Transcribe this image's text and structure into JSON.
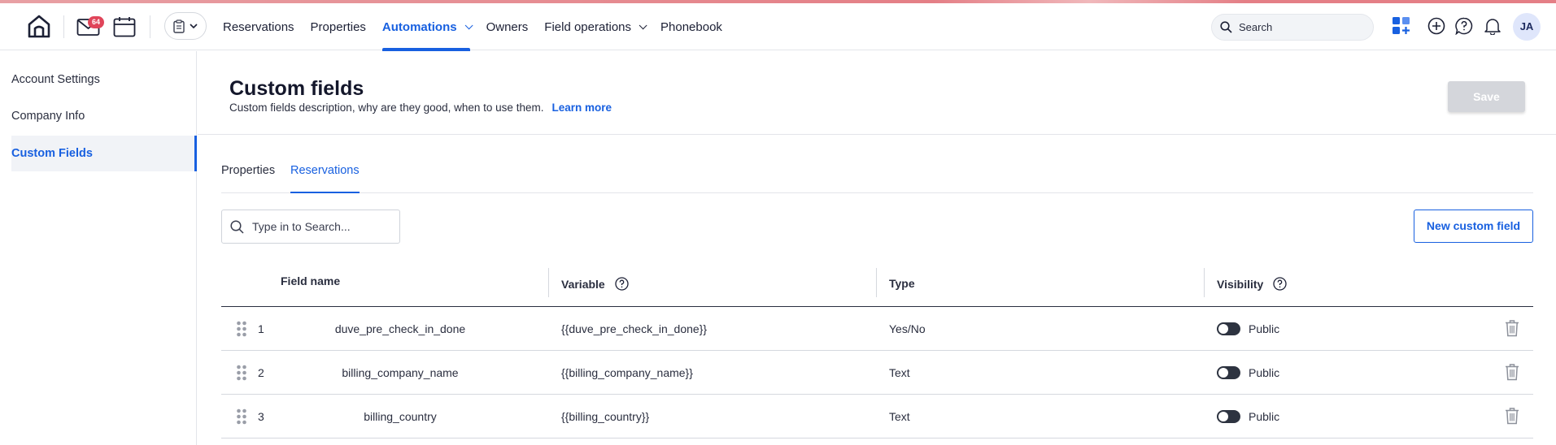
{
  "topbar": {
    "mail_badge": "64",
    "nav": [
      {
        "label": "Reservations",
        "has_caret": false,
        "active": false
      },
      {
        "label": "Properties",
        "has_caret": false,
        "active": false
      },
      {
        "label": "Automations",
        "has_caret": true,
        "active": true
      },
      {
        "label": "Owners",
        "has_caret": false,
        "active": false
      },
      {
        "label": "Field operations",
        "has_caret": true,
        "active": false
      },
      {
        "label": "Phonebook",
        "has_caret": false,
        "active": false
      }
    ],
    "search_label": "Search",
    "avatar_initials": "JA",
    "accent_color": "#1860e0",
    "badge_color": "#e0455a"
  },
  "sidebar": {
    "items": [
      {
        "label": "Account Settings",
        "active": false
      },
      {
        "label": "Company Info",
        "active": false
      },
      {
        "label": "Custom Fields",
        "active": true
      }
    ]
  },
  "header": {
    "title": "Custom fields",
    "description": "Custom fields description, why are they good, when to use them.",
    "learn_more": "Learn more",
    "save_label": "Save"
  },
  "tabs": [
    {
      "label": "Properties",
      "active": false
    },
    {
      "label": "Reservations",
      "active": true
    }
  ],
  "toolbar": {
    "search_placeholder": "Type in to Search...",
    "new_button": "New custom field"
  },
  "table": {
    "columns": {
      "field_name": "Field name",
      "variable": "Variable",
      "type": "Type",
      "visibility": "Visibility"
    },
    "rows": [
      {
        "index": "1",
        "field_name": "duve_pre_check_in_done",
        "variable": "{{duve_pre_check_in_done}}",
        "type": "Yes/No",
        "visibility": "Public"
      },
      {
        "index": "2",
        "field_name": "billing_company_name",
        "variable": "{{billing_company_name}}",
        "type": "Text",
        "visibility": "Public"
      },
      {
        "index": "3",
        "field_name": "billing_country",
        "variable": "{{billing_country}}",
        "type": "Text",
        "visibility": "Public"
      }
    ]
  }
}
